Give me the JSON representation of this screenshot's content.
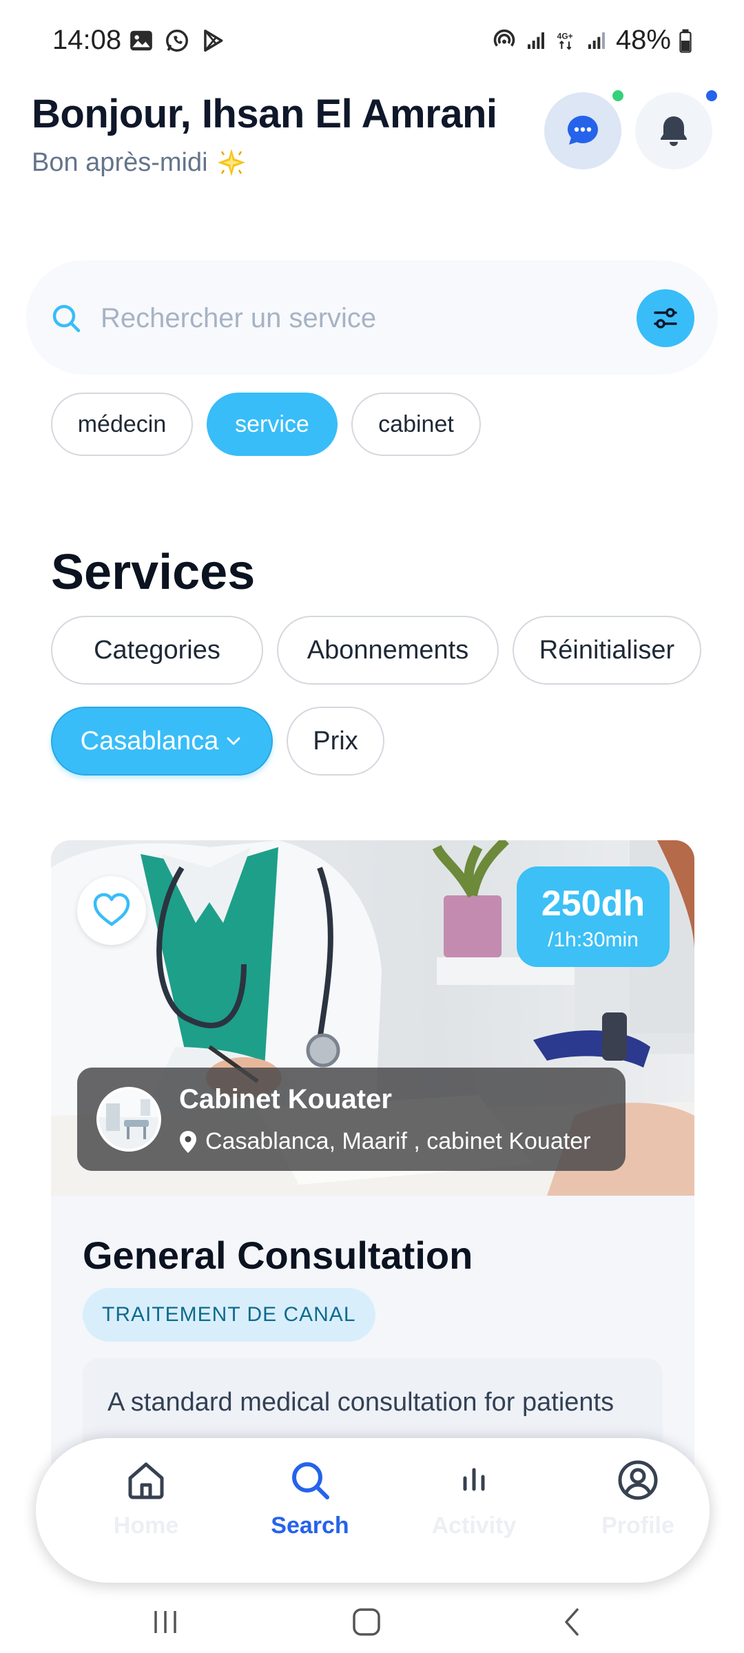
{
  "status_bar": {
    "time": "14:08",
    "battery": "48%",
    "icons": [
      "gallery-icon",
      "whatsapp-icon",
      "play-store-icon",
      "hotspot-icon",
      "signal-icon",
      "4g-icon",
      "signal-icon",
      "battery-icon"
    ]
  },
  "header": {
    "greeting": "Bonjour, Ihsan El Amrani",
    "subgreeting": "Bon après-midi",
    "chat_indicator_color": "#34d17a",
    "notification_indicator_color": "#2563eb"
  },
  "search": {
    "placeholder": "Rechercher un service",
    "value": ""
  },
  "search_types": [
    {
      "label": "médecin",
      "active": false
    },
    {
      "label": "service",
      "active": true
    },
    {
      "label": "cabinet",
      "active": false
    }
  ],
  "section": {
    "title": "Services"
  },
  "filters": [
    {
      "label": "Categories",
      "active": false
    },
    {
      "label": "Abonnements",
      "active": false
    },
    {
      "label": "Réinitialiser",
      "active": false
    },
    {
      "label": "Casablanca",
      "active": true,
      "dropdown": true
    },
    {
      "label": "Prix",
      "active": false
    }
  ],
  "card": {
    "price": "250dh",
    "duration": "/1h:30min",
    "provider_name": "Cabinet Kouater",
    "provider_location": "Casablanca, Maarif , cabinet Kouater",
    "title": "General Consultation",
    "tag": "TRAITEMENT DE CANAL",
    "description": "A standard medical consultation for patients"
  },
  "bottom_nav": [
    {
      "label": "Home",
      "icon": "home-icon",
      "active": false
    },
    {
      "label": "Search",
      "icon": "search-icon",
      "active": true
    },
    {
      "label": "Activity",
      "icon": "activity-icon",
      "active": false
    },
    {
      "label": "Profile",
      "icon": "profile-icon",
      "active": false
    }
  ],
  "colors": {
    "accent": "#38bdf8",
    "active_nav": "#2563eb",
    "heading": "#0f172a"
  }
}
